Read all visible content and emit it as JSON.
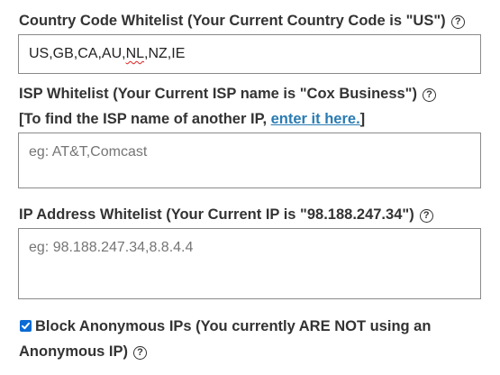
{
  "country": {
    "label": "Country Code Whitelist (Your Current Country Code is \"US\")",
    "value_parts": [
      "US,GB,CA,AU,",
      "NL",
      ",NZ,IE"
    ]
  },
  "isp": {
    "label": "ISP Whitelist (Your Current ISP name is \"Cox Business\")",
    "hint_prefix": "[To find the ISP name of another IP, ",
    "hint_link": "enter it here.",
    "hint_suffix": "]",
    "placeholder": "eg: AT&T,Comcast"
  },
  "ip": {
    "label": "IP Address Whitelist (Your Current IP is \"98.188.247.34\")",
    "placeholder": "eg: 98.188.247.34,8.8.4.4"
  },
  "anonymous": {
    "checked": true,
    "label_line1": "Block Anonymous IPs (You currently ARE NOT using an",
    "label_line2": "Anonymous IP)"
  },
  "icons": {
    "help": "?",
    "accent": "#0b6bd4",
    "link_color": "#2a7bb3"
  }
}
